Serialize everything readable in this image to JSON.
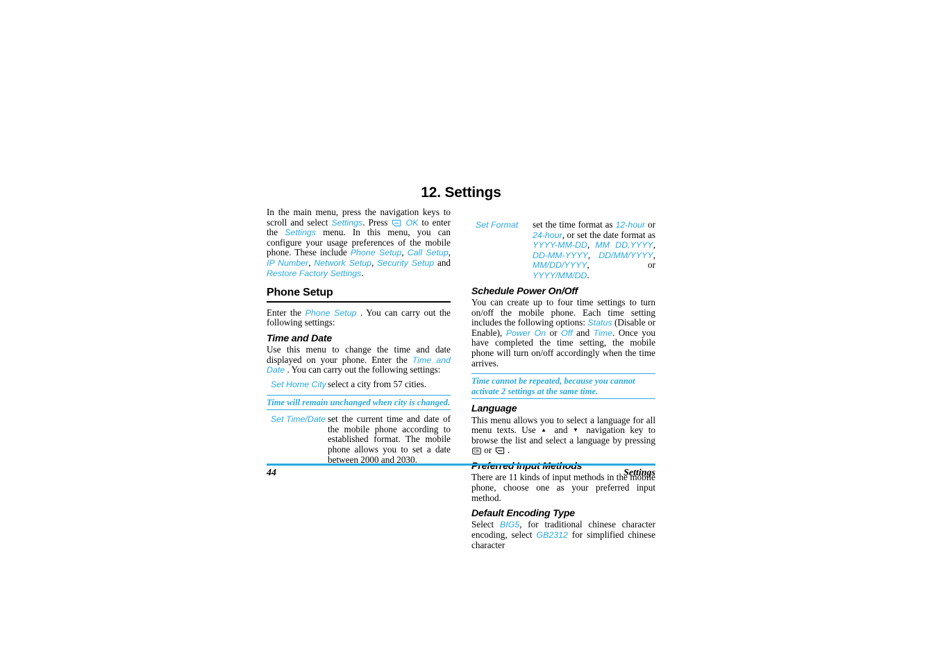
{
  "document": {
    "chapter_title": "12. Settings",
    "accent_color": "#29A8E0",
    "rule_color": "#000000"
  },
  "left_column": {
    "intro": {
      "part1": "In the main menu, press the navigation keys to scroll and select ",
      "link1": "Settings",
      "part2": ". Press ",
      "softkey_icon": "softkey-icon",
      "link2": "OK",
      "part3": " to enter the ",
      "link3": "Settings",
      "part4": " menu. In this menu, you can configure your usage preferences of the mobile phone. These include ",
      "link4": "Phone Setup",
      "sep1": ", ",
      "link5": "Call Setup",
      "sep2": ", ",
      "link6": "IP Number",
      "sep3": ", ",
      "link7": "Network Setup",
      "sep4": ", ",
      "link8": "Security Setup",
      "part5": " and ",
      "link9": "Restore Factory Settings",
      "part6": "."
    },
    "section": {
      "heading": "Phone Setup",
      "intro_part1": "Enter the ",
      "intro_link": "Phone Setup",
      "intro_part2": " . You can carry out the following settings:"
    },
    "time_and_date": {
      "heading": "Time and Date",
      "body_part1": "Use this menu to change the time and date displayed on your phone. Enter the ",
      "body_link": "Time and Date",
      "body_part2": " . You can carry out the following settings:"
    },
    "set_home_city": {
      "term": "Set Home City",
      "description": "select a city from 57 cities."
    },
    "note_city": {
      "text": "Time will remain unchanged when city is changed."
    },
    "set_time_date": {
      "term": "Set Time/Date",
      "description": "set the current time and date of the mobile phone according to established format. The mobile phone allows you to set a date between 2000 and 2030."
    }
  },
  "right_column": {
    "set_format": {
      "term": "Set Format",
      "d_part1": "set the time format as ",
      "d_link1": "12-hour",
      "d_part2": " or ",
      "d_link2": "24-hour",
      "d_part3": ", or set the date format as ",
      "d_link3": "YYYY-MM-DD",
      "d_sep1": ", ",
      "d_link4": "MM DD,YYYY",
      "d_sep2": ", ",
      "d_link5": "DD-MM-YYYY",
      "d_sep3": ", ",
      "d_link6": "DD/MM/YYYY",
      "d_sep4": ", ",
      "d_link7": "MM/DD/YYYY",
      "d_part4": ", or ",
      "d_link8": "YYYY/MM/DD",
      "d_part5": "."
    },
    "schedule_power": {
      "heading": "Schedule Power On/Off",
      "p_part1": "You can create up to four time settings to turn on/off the mobile phone. Each time setting includes the following options: ",
      "p_link1": "Status",
      "p_part2": " (Disable or Enable), ",
      "p_link2": "Power On",
      "p_part3": " or ",
      "p_link3": "Off",
      "p_part4": " and ",
      "p_link4": "Time",
      "p_part5": ". Once you have completed the time setting, the mobile phone will turn on/off accordingly when the time arrives."
    },
    "note_repeat": {
      "text": "Time cannot be repeated, because you cannot activate 2 settings at the same time."
    },
    "language": {
      "heading": "Language",
      "p_part1": "This menu allows you to select a language for all menu texts. Use ",
      "arrow_up": "▲",
      "p_part2": " and ",
      "arrow_down": "▼",
      "p_part3": " navigation key to browse the list and select a language by pressing ",
      "ok_icon": "ok-key-icon",
      "p_part4": " or ",
      "softkey_icon": "softkey-icon",
      "p_part5": " ."
    },
    "input_methods": {
      "heading": "Preferred Input Methods",
      "body": "There are 11 kinds of input methods in the mobile phone, choose one as your preferred input method."
    },
    "encoding": {
      "heading": "Default Encoding Type",
      "e_part1": "Select ",
      "e_link1": "BIG5",
      "e_part2": ", for traditional chinese character encoding, select ",
      "e_link2": "GB2312",
      "e_part3": " for simplified chinese character"
    }
  },
  "footer": {
    "page_number": "44",
    "running_head": "Settings"
  }
}
